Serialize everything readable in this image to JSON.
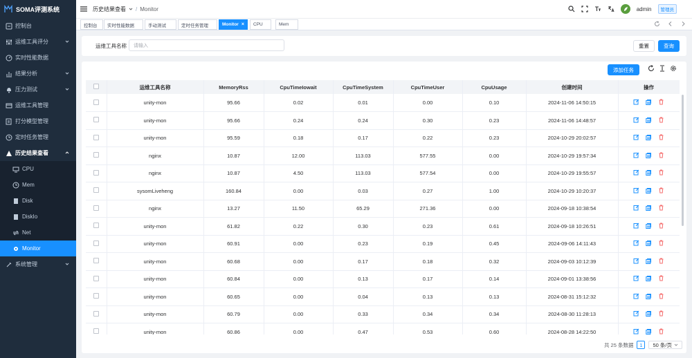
{
  "app": {
    "title": "SOMA评测系统"
  },
  "sidebar": {
    "items": [
      {
        "label": "控制台",
        "icon": "dashboard-icon"
      },
      {
        "label": "运维工具评分",
        "icon": "sliders-icon",
        "expandable": true
      },
      {
        "label": "实时性能数据",
        "icon": "gauge-icon"
      },
      {
        "label": "结果分析",
        "icon": "chart-icon",
        "expandable": true
      },
      {
        "label": "压力测试",
        "icon": "bell-icon",
        "expandable": true
      },
      {
        "label": "运维工具管理",
        "icon": "panel-icon"
      },
      {
        "label": "打分模型管理",
        "icon": "edit-icon"
      },
      {
        "label": "定时任务管理",
        "icon": "clock-icon"
      },
      {
        "label": "历史结果查看",
        "icon": "history-icon",
        "expandable": true,
        "open": true
      }
    ],
    "subitems": [
      {
        "label": "CPU",
        "icon": "monitor-icon"
      },
      {
        "label": "Mem",
        "icon": "clock-icon"
      },
      {
        "label": "Disk",
        "icon": "document-icon"
      },
      {
        "label": "DiskIo",
        "icon": "document-icon"
      },
      {
        "label": "Net",
        "icon": "network-icon"
      },
      {
        "label": "Monitor",
        "icon": "gear-icon",
        "active": true
      }
    ],
    "last": {
      "label": "系统管理",
      "icon": "settings-icon",
      "expandable": true
    }
  },
  "header": {
    "breadcrumb": [
      "历史结果查看",
      "Monitor"
    ],
    "user": "admin",
    "role": "管理员"
  },
  "tags": [
    {
      "label": "控制台"
    },
    {
      "label": "实时性能数据"
    },
    {
      "label": "手动测试"
    },
    {
      "label": "定时任务管理"
    },
    {
      "label": "Monitor",
      "active": true
    },
    {
      "label": "CPU"
    },
    {
      "label": "Mem"
    }
  ],
  "search": {
    "label": "运维工具名称",
    "placeholder": "请输入",
    "reset": "重置",
    "query": "查询"
  },
  "toolbar": {
    "add": "添加任务"
  },
  "table": {
    "columns": [
      "运维工具名称",
      "MemoryRss",
      "CpuTimeIowait",
      "CpuTimeSystem",
      "CpuTimeUser",
      "CpuUsage",
      "创建时间",
      "操作"
    ],
    "rows": [
      [
        "unity-mon",
        "95.66",
        "0.02",
        "0.01",
        "0.00",
        "0.10",
        "2024-11-06 14:50:15"
      ],
      [
        "unity-mon",
        "95.66",
        "0.24",
        "0.24",
        "0.30",
        "0.23",
        "2024-11-06 14:48:57"
      ],
      [
        "unity-mon",
        "95.59",
        "0.18",
        "0.17",
        "0.22",
        "0.23",
        "2024-10-29 20:02:57"
      ],
      [
        "nginx",
        "10.87",
        "12.00",
        "113.03",
        "577.55",
        "0.00",
        "2024-10-29 19:57:34"
      ],
      [
        "nginx",
        "10.87",
        "4.50",
        "113.03",
        "577.54",
        "0.00",
        "2024-10-29 19:55:57"
      ],
      [
        "sysomLiveheng",
        "160.84",
        "0.00",
        "0.03",
        "0.27",
        "1.00",
        "2024-10-29 10:20:37"
      ],
      [
        "nginx",
        "13.27",
        "11.50",
        "65.29",
        "271.36",
        "0.00",
        "2024-09-18 10:38:54"
      ],
      [
        "unity-mon",
        "61.82",
        "0.22",
        "0.30",
        "0.23",
        "0.61",
        "2024-09-18 10:26:51"
      ],
      [
        "unity-mon",
        "60.91",
        "0.00",
        "0.23",
        "0.19",
        "0.45",
        "2024-09-06 14:11:43"
      ],
      [
        "unity-mon",
        "60.68",
        "0.00",
        "0.17",
        "0.18",
        "0.32",
        "2024-09-03 10:12:39"
      ],
      [
        "unity-mon",
        "60.84",
        "0.00",
        "0.13",
        "0.17",
        "0.14",
        "2024-09-01 13:38:56"
      ],
      [
        "unity-mon",
        "60.65",
        "0.00",
        "0.04",
        "0.13",
        "0.13",
        "2024-08-31 15:12:32"
      ],
      [
        "unity-mon",
        "60.79",
        "0.00",
        "0.33",
        "0.34",
        "0.34",
        "2024-08-30 11:28:13"
      ],
      [
        "unity-mon",
        "60.86",
        "0.00",
        "0.47",
        "0.53",
        "0.60",
        "2024-08-28 14:22:50"
      ]
    ]
  },
  "pagination": {
    "total": "共 25 条数据",
    "page": "1",
    "size": "50 条/页"
  },
  "colors": {
    "accent": "#1890ff",
    "sidebar": "#1f2d3d",
    "danger": "#f56c6c"
  }
}
